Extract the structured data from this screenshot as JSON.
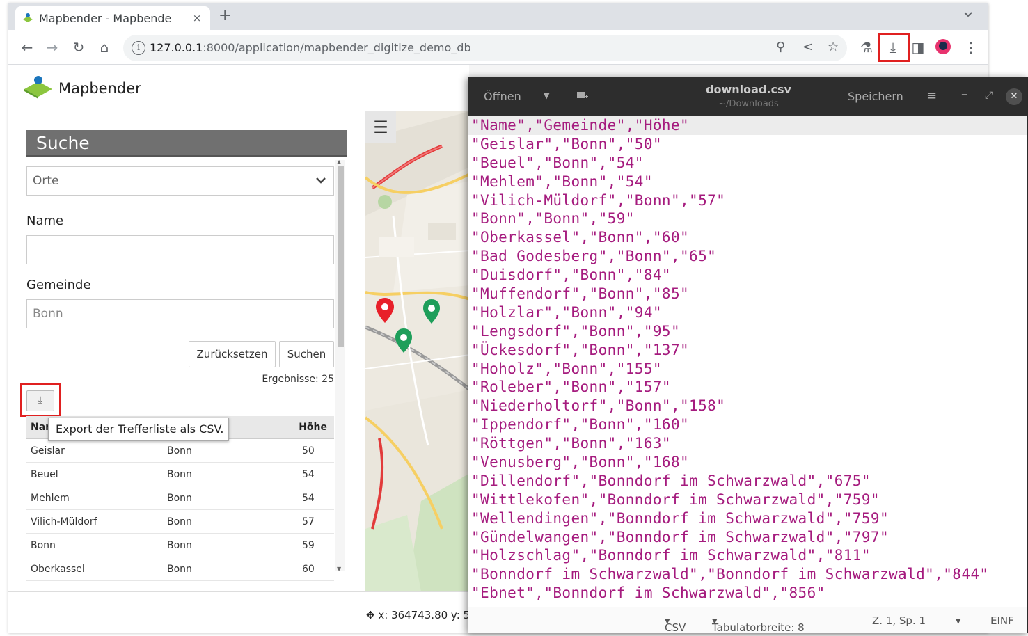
{
  "browser": {
    "tab_title": "Mapbender - Mapbende",
    "tab_close": "×",
    "new_tab": "+",
    "url_host": "127.0.0.1",
    "url_rest": ":8000/application/mapbender_digitize_demo_db",
    "icons": {
      "back": "←",
      "forward": "→",
      "reload": "↻",
      "home": "⌂",
      "zoom": "⚲",
      "share": "<",
      "star": "☆",
      "labs": "⚗",
      "download": "⤓",
      "sidepanel": "◨",
      "menu": "⋮",
      "tablist": "⌄"
    }
  },
  "app": {
    "title": "Mapbender",
    "search": {
      "heading": "Suche",
      "type_select": "Orte",
      "name_label": "Name",
      "name_value": "",
      "gemeinde_label": "Gemeinde",
      "gemeinde_value": "Bonn",
      "reset_label": "Zurücksetzen",
      "search_label": "Suchen",
      "results_count": "Ergebnisse: 25",
      "export_icon": "⤓",
      "export_tooltip": "Export der Trefferliste als CSV."
    },
    "table": {
      "headers": {
        "name": "Nar",
        "hoehe": "Höhe"
      },
      "rows": [
        {
          "name": "Geislar",
          "gemeinde": "Bonn",
          "hoehe": "50"
        },
        {
          "name": "Beuel",
          "gemeinde": "Bonn",
          "hoehe": "54"
        },
        {
          "name": "Mehlem",
          "gemeinde": "Bonn",
          "hoehe": "54"
        },
        {
          "name": "Vilich-Müldorf",
          "gemeinde": "Bonn",
          "hoehe": "57"
        },
        {
          "name": "Bonn",
          "gemeinde": "Bonn",
          "hoehe": "59"
        },
        {
          "name": "Oberkassel",
          "gemeinde": "Bonn",
          "hoehe": "60"
        }
      ]
    },
    "map_menu_icon": "☰",
    "coords": "x: 364743.80 y: 5",
    "colors": {
      "marker_red": "#e8202a",
      "marker_green": "#1e9e5a",
      "heading_bg": "#707070"
    }
  },
  "editor": {
    "open_label": "Öffnen",
    "save_label": "Speichern",
    "filename": "download.csv",
    "path": "~/Downloads",
    "lines": [
      "\"Name\",\"Gemeinde\",\"Höhe\"",
      "\"Geislar\",\"Bonn\",\"50\"",
      "\"Beuel\",\"Bonn\",\"54\"",
      "\"Mehlem\",\"Bonn\",\"54\"",
      "\"Vilich-Müldorf\",\"Bonn\",\"57\"",
      "\"Bonn\",\"Bonn\",\"59\"",
      "\"Oberkassel\",\"Bonn\",\"60\"",
      "\"Bad Godesberg\",\"Bonn\",\"65\"",
      "\"Duisdorf\",\"Bonn\",\"84\"",
      "\"Muffendorf\",\"Bonn\",\"85\"",
      "\"Holzlar\",\"Bonn\",\"94\"",
      "\"Lengsdorf\",\"Bonn\",\"95\"",
      "\"Ückesdorf\",\"Bonn\",\"137\"",
      "\"Hoholz\",\"Bonn\",\"155\"",
      "\"Roleber\",\"Bonn\",\"157\"",
      "\"Niederholtorf\",\"Bonn\",\"158\"",
      "\"Ippendorf\",\"Bonn\",\"160\"",
      "\"Röttgen\",\"Bonn\",\"163\"",
      "\"Venusberg\",\"Bonn\",\"168\"",
      "\"Dillendorf\",\"Bonndorf im Schwarzwald\",\"675\"",
      "\"Wittlekofen\",\"Bonndorf im Schwarzwald\",\"759\"",
      "\"Wellendingen\",\"Bonndorf im Schwarzwald\",\"759\"",
      "\"Gündelwangen\",\"Bonndorf im Schwarzwald\",\"797\"",
      "\"Holzschlag\",\"Bonndorf im Schwarzwald\",\"811\"",
      "\"Bonndorf im Schwarzwald\",\"Bonndorf im Schwarzwald\",\"844\"",
      "\"Ebnet\",\"Bonndorf im Schwarzwald\",\"856\""
    ],
    "status": {
      "language": "CSV",
      "tab_width": "Tabulatorbreite: 8",
      "position": "Z. 1, Sp. 1",
      "mode": "EINF"
    }
  }
}
